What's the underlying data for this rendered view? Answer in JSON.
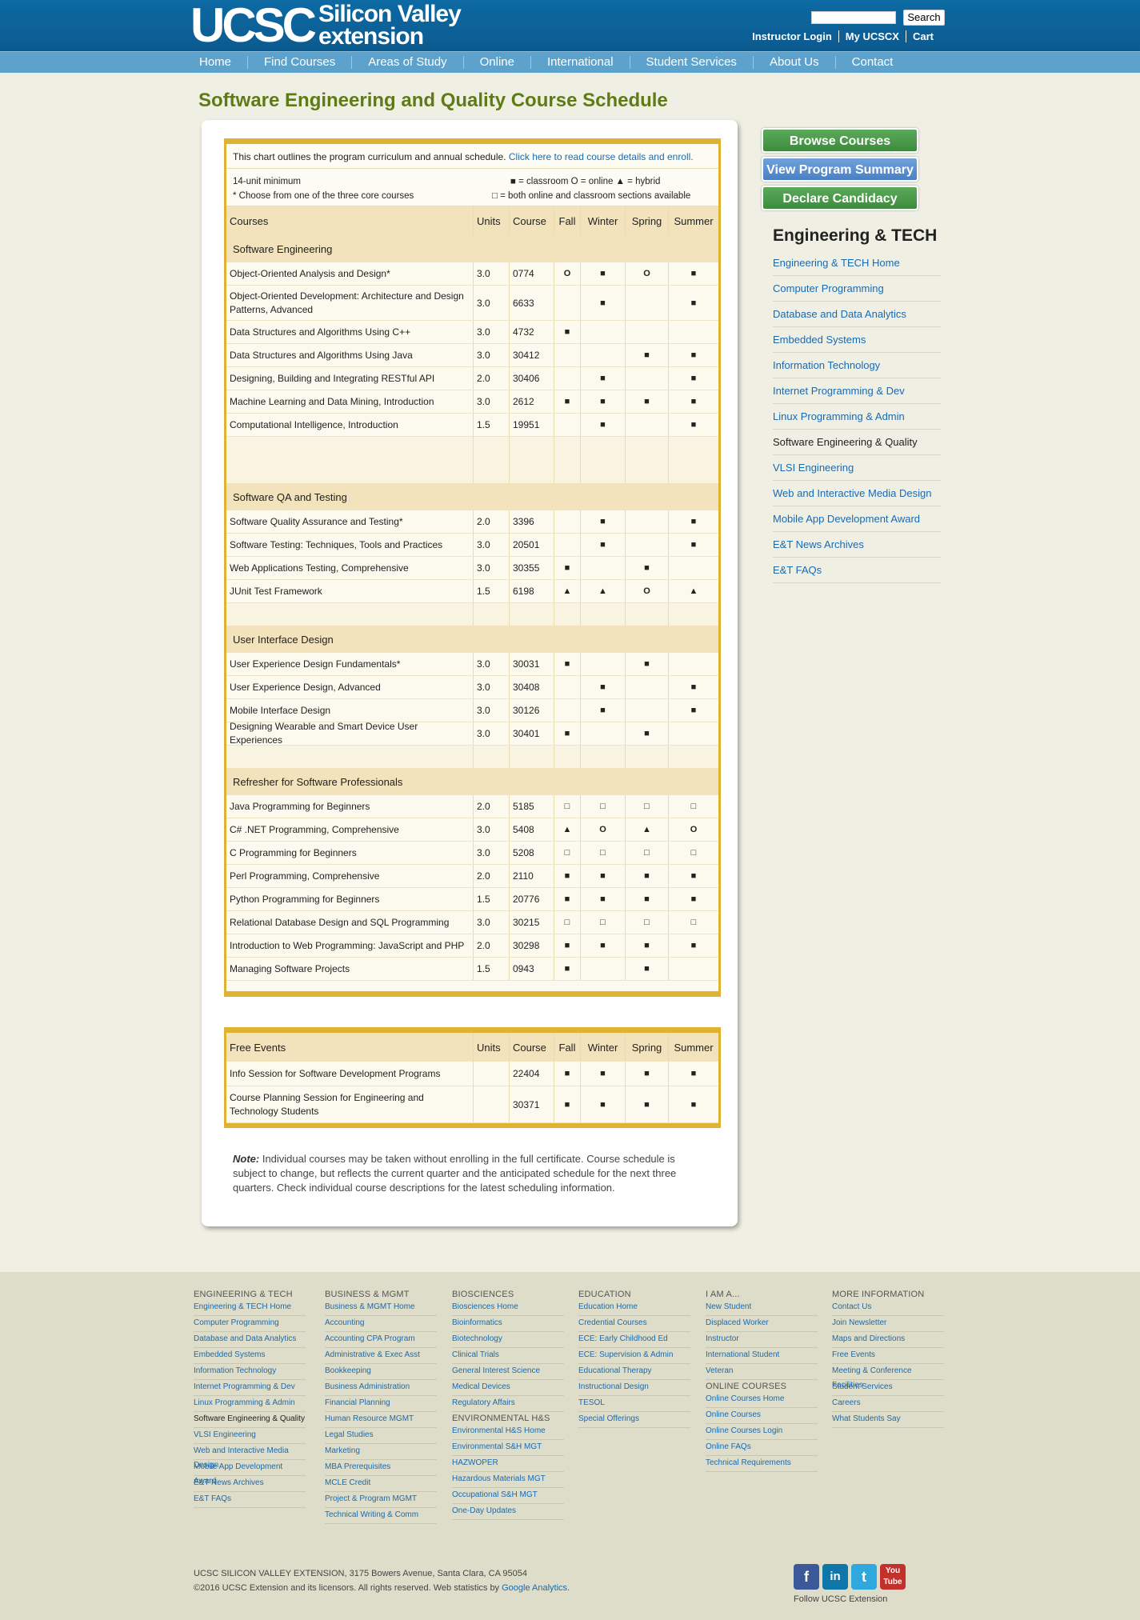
{
  "header": {
    "logo_main": "UCSC",
    "logo_top": "Silicon Valley",
    "logo_bottom": "extension",
    "search_button": "Search",
    "links": [
      "Instructor Login",
      "My UCSCX",
      "Cart"
    ]
  },
  "nav": [
    "Home",
    "Find Courses",
    "Areas of Study",
    "Online",
    "International",
    "Student Services",
    "About Us",
    "Contact"
  ],
  "page_title": "Software Engineering and Quality Course Schedule",
  "intro": {
    "text": "This chart outlines the program curriculum and annual schedule.",
    "link": "Click here to read course details and enroll."
  },
  "legend": {
    "units": "14-unit minimum",
    "core": "* Choose from one of the three core courses",
    "line1": "■ = classroom   O = online   ▲ = hybrid",
    "line2": "□ = both online and classroom sections available"
  },
  "columns": [
    "Courses",
    "Units",
    "Course",
    "Fall",
    "Winter",
    "Spring",
    "Summer"
  ],
  "sections": [
    {
      "name": "Software Engineering",
      "courses": [
        {
          "title": "Object-Oriented Analysis and Design*",
          "units": "3.0",
          "num": "0774",
          "fall": "O",
          "winter": "■",
          "spring": "O",
          "summer": "■"
        },
        {
          "title": "Object-Oriented Development: Architecture and Design Patterns, Advanced",
          "units": "3.0",
          "num": "6633",
          "fall": "",
          "winter": "■",
          "spring": "",
          "summer": "■"
        },
        {
          "title": "Data Structures and Algorithms Using C++",
          "units": "3.0",
          "num": "4732",
          "fall": "■",
          "winter": "",
          "spring": "",
          "summer": ""
        },
        {
          "title": "Data Structures and Algorithms Using Java",
          "units": "3.0",
          "num": "30412",
          "fall": "",
          "winter": "",
          "spring": "■",
          "summer": "■"
        },
        {
          "title": "Designing, Building and Integrating RESTful API",
          "units": "2.0",
          "num": "30406",
          "fall": "",
          "winter": "■",
          "spring": "",
          "summer": "■"
        },
        {
          "title": "Machine Learning and Data Mining, Introduction",
          "units": "3.0",
          "num": "2612",
          "fall": "■",
          "winter": "■",
          "spring": "■",
          "summer": "■"
        },
        {
          "title": "Computational Intelligence, Introduction",
          "units": "1.5",
          "num": "19951",
          "fall": "",
          "winter": "■",
          "spring": "",
          "summer": "■"
        }
      ]
    },
    {
      "name": "Software QA and Testing",
      "courses": [
        {
          "title": "Software Quality Assurance and Testing*",
          "units": "2.0",
          "num": "3396",
          "fall": "",
          "winter": "■",
          "spring": "",
          "summer": "■"
        },
        {
          "title": "Software Testing: Techniques, Tools and Practices",
          "units": "3.0",
          "num": "20501",
          "fall": "",
          "winter": "■",
          "spring": "",
          "summer": "■"
        },
        {
          "title": "Web Applications Testing, Comprehensive",
          "units": "3.0",
          "num": "30355",
          "fall": "■",
          "winter": "",
          "spring": "■",
          "summer": ""
        },
        {
          "title": "JUnit Test Framework",
          "units": "1.5",
          "num": "6198",
          "fall": "▲",
          "winter": "▲",
          "spring": "O",
          "summer": "▲"
        }
      ]
    },
    {
      "name": "User Interface Design",
      "courses": [
        {
          "title": "User Experience Design Fundamentals*",
          "units": "3.0",
          "num": "30031",
          "fall": "■",
          "winter": "",
          "spring": "■",
          "summer": ""
        },
        {
          "title": "User Experience Design, Advanced",
          "units": "3.0",
          "num": "30408",
          "fall": "",
          "winter": "■",
          "spring": "",
          "summer": "■"
        },
        {
          "title": "Mobile Interface Design",
          "units": "3.0",
          "num": "30126",
          "fall": "",
          "winter": "■",
          "spring": "",
          "summer": "■"
        },
        {
          "title": "Designing Wearable and Smart Device User Experiences",
          "units": "3.0",
          "num": "30401",
          "fall": "■",
          "winter": "",
          "spring": "■",
          "summer": ""
        }
      ]
    },
    {
      "name": "Refresher for Software Professionals",
      "courses": [
        {
          "title": "Java Programming for Beginners",
          "units": "2.0",
          "num": "5185",
          "fall": "□",
          "winter": "□",
          "spring": "□",
          "summer": "□"
        },
        {
          "title": "C# .NET Programming, Comprehensive",
          "units": "3.0",
          "num": "5408",
          "fall": "▲",
          "winter": "O",
          "spring": "▲",
          "summer": "O"
        },
        {
          "title": "C Programming for Beginners",
          "units": "3.0",
          "num": "5208",
          "fall": "□",
          "winter": "□",
          "spring": "□",
          "summer": "□"
        },
        {
          "title": "Perl Programming, Comprehensive",
          "units": "2.0",
          "num": "2110",
          "fall": "■",
          "winter": "■",
          "spring": "■",
          "summer": "■"
        },
        {
          "title": "Python Programming for Beginners",
          "units": "1.5",
          "num": "20776",
          "fall": "■",
          "winter": "■",
          "spring": "■",
          "summer": "■"
        },
        {
          "title": "Relational Database Design and SQL Programming",
          "units": "3.0",
          "num": "30215",
          "fall": "□",
          "winter": "□",
          "spring": "□",
          "summer": "□"
        },
        {
          "title": "Introduction to Web Programming: JavaScript and PHP",
          "units": "2.0",
          "num": "30298",
          "fall": "■",
          "winter": "■",
          "spring": "■",
          "summer": "■"
        },
        {
          "title": "Managing Software Projects",
          "units": "1.5",
          "num": "0943",
          "fall": "■",
          "winter": "",
          "spring": "■",
          "summer": ""
        }
      ]
    }
  ],
  "free_events": {
    "columns": [
      "Free Events",
      "Units",
      "Course",
      "Fall",
      "Winter",
      "Spring",
      "Summer"
    ],
    "rows": [
      {
        "title": "Info Session for Software Development Programs",
        "units": "",
        "num": "22404",
        "fall": "■",
        "winter": "■",
        "spring": "■",
        "summer": "■"
      },
      {
        "title": "Course Planning Session for Engineering and Technology Students",
        "units": "",
        "num": "30371",
        "fall": "■",
        "winter": "■",
        "spring": "■",
        "summer": "■"
      }
    ]
  },
  "note": {
    "label": "Note:",
    "text": " Individual courses may be taken without enrolling in the full certificate. Course schedule is subject to change, but reflects the current quarter and the anticipated schedule for the next three quarters. Check individual course descriptions for the latest scheduling information."
  },
  "sidebar": {
    "buttons": [
      "Browse Courses",
      "View Program Summary",
      "Declare Candidacy"
    ],
    "title": "Engineering & TECH",
    "links": [
      "Engineering & TECH Home",
      "Computer Programming",
      "Database and Data Analytics",
      "Embedded Systems",
      "Information Technology",
      "Internet Programming & Dev",
      "Linux Programming & Admin",
      "Software Engineering & Quality",
      "VLSI Engineering",
      "Web and Interactive Media Design",
      "Mobile App Development Award",
      "E&T News Archives",
      "E&T FAQs"
    ]
  },
  "footer": {
    "columns": [
      {
        "title": "ENGINEERING & TECH",
        "links": [
          "Engineering & TECH Home",
          "Computer Programming",
          "Database and Data Analytics",
          "Embedded Systems",
          "Information Technology",
          "Internet Programming & Dev",
          "Linux Programming & Admin",
          "Software Engineering & Quality",
          "VLSI Engineering",
          "Web and Interactive Media Design",
          "Mobile App Development Award",
          "E&T News Archives",
          "E&T FAQs"
        ]
      },
      {
        "title": "BUSINESS & MGMT",
        "links": [
          "Business & MGMT Home",
          "Accounting",
          "Accounting CPA Program",
          "Administrative & Exec Asst",
          "Bookkeeping",
          "Business Administration",
          "Financial Planning",
          "Human Resource MGMT",
          "Legal Studies",
          "Marketing",
          "MBA Prerequisites",
          "MCLE Credit",
          "Project & Program MGMT",
          "Technical Writing & Comm"
        ]
      },
      {
        "title": "BIOSCIENCES",
        "links": [
          "Biosciences Home",
          "Bioinformatics",
          "Biotechnology",
          "Clinical Trials",
          "General Interest Science",
          "Medical Devices",
          "Regulatory Affairs"
        ],
        "title2": "ENVIRONMENTAL H&S",
        "links2": [
          "Environmental H&S Home",
          "Environmental S&H MGT",
          "HAZWOPER",
          "Hazardous Materials MGT",
          "Occupational S&H MGT",
          "One-Day Updates"
        ]
      },
      {
        "title": "EDUCATION",
        "links": [
          "Education Home",
          "Credential Courses",
          "ECE: Early Childhood Ed",
          "ECE: Supervision & Admin",
          "Educational Therapy",
          "Instructional Design",
          "TESOL",
          "Special Offerings"
        ]
      },
      {
        "title": "I AM A...",
        "links": [
          "New Student",
          "Displaced Worker",
          "Instructor",
          "International Student",
          "Veteran"
        ],
        "title2": "ONLINE COURSES",
        "links2": [
          "Online Courses Home",
          "Online Courses",
          "Online Courses Login",
          "Online FAQs",
          "Technical Requirements"
        ]
      },
      {
        "title": "MORE INFORMATION",
        "links": [
          "Contact Us",
          "Join Newsletter",
          "Maps and Directions",
          "Free Events",
          "Meeting & Conference Facilities",
          "Student Services",
          "Careers",
          "What Students Say"
        ]
      }
    ],
    "address": "UCSC SILICON VALLEY EXTENSION, 3175 Bowers Avenue, Santa Clara, CA 95054",
    "copyright": "©2016 UCSC Extension and its licensors. All rights reserved. Web statistics by ",
    "analytics": "Google Analytics.",
    "social": [
      "f",
      "in",
      "t",
      "You Tube"
    ],
    "follow": "Follow UCSC Extension"
  }
}
